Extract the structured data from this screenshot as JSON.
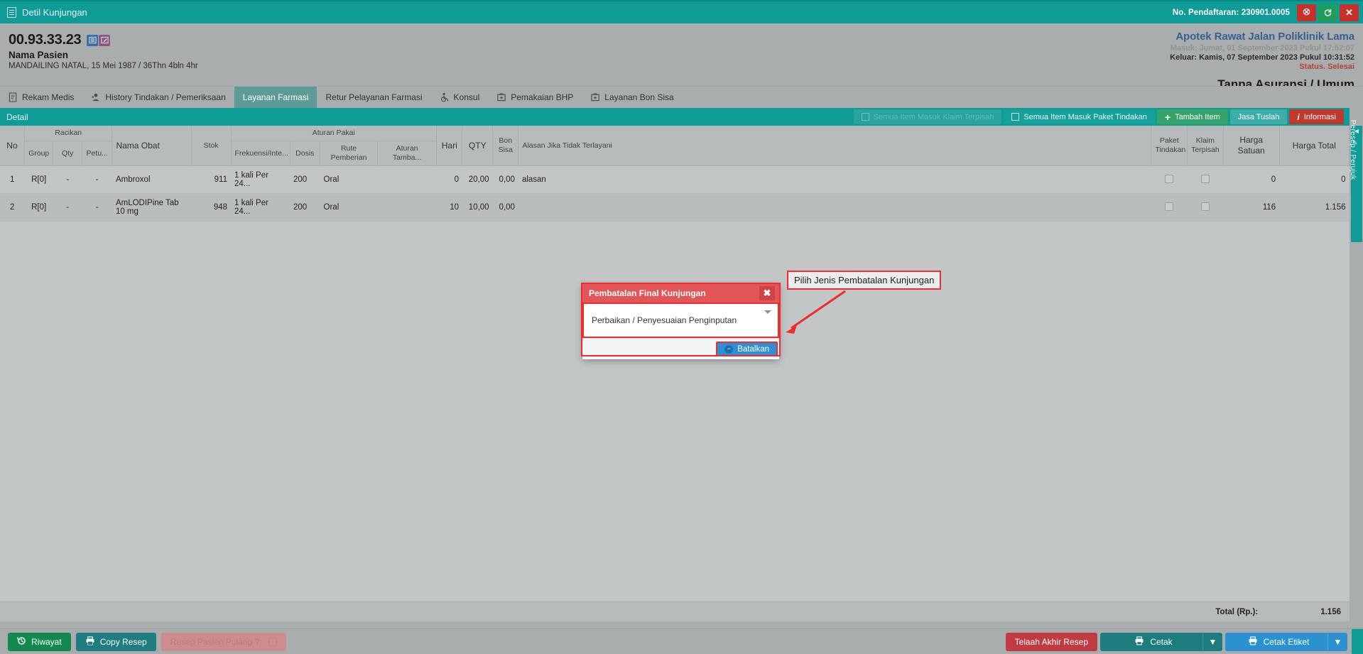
{
  "titlebar": {
    "title": "Detil Kunjungan",
    "doc_icon": "document-icon",
    "registration_label": "No. Pendaftaran: 230901.0005",
    "btn_unlink": "unlink-icon",
    "btn_refresh": "refresh-icon",
    "btn_close": "close-icon"
  },
  "patient": {
    "mrn": "00.93.33.23",
    "icon_list": "list-icon",
    "icon_edit": "edit-icon",
    "name": "Nama Pasien",
    "info": "MANDAILING NATAL, 15 Mei 1987 / 36Thn 4bln 4hr"
  },
  "visit": {
    "clinic": "Apotek Rawat Jalan Poliklinik Lama",
    "masuk": "Masuk: Jumat, 01 September 2023 Pukul 17:52:07",
    "keluar": "Keluar: Kamis, 07 September 2023 Pukul 10:31:52",
    "status": "Status. Selesai",
    "insurance": "Tanpa Asuransi / Umum"
  },
  "tabs": [
    {
      "label": "Rekam Medis",
      "icon": "document-icon",
      "active": false
    },
    {
      "label": "History Tindakan / Pemeriksaan",
      "icon": "patient-icon",
      "active": false
    },
    {
      "label": "Layanan Farmasi",
      "icon": "none",
      "active": true
    },
    {
      "label": "Retur Pelayanan Farmasi",
      "icon": "none",
      "active": false
    },
    {
      "label": "Konsul",
      "icon": "wheelchair-icon",
      "active": false
    },
    {
      "label": "Pemakaian BHP",
      "icon": "medkit-icon",
      "active": false
    },
    {
      "label": "Layanan Bon Sisa",
      "icon": "medkit-icon",
      "active": false
    }
  ],
  "detailbar": {
    "label": "Detail",
    "actions": [
      {
        "name": "semua-item-masuk-klaim-terpisah",
        "label": "Semua Item Masuk Klaim Terpisah",
        "style": "ghost",
        "checkbox": true
      },
      {
        "name": "semua-item-masuk-paket-tindakan",
        "label": "Semua Item Masuk Paket Tindakan",
        "style": "chk",
        "checkbox": true
      },
      {
        "name": "tambah-item",
        "label": "Tambah Item",
        "style": "green",
        "icon": "plus-icon"
      },
      {
        "name": "jasa-tuslah",
        "label": "Jasa Tuslah",
        "style": "teal"
      },
      {
        "name": "informasi",
        "label": "Informasi",
        "style": "red",
        "icon": "info-icon"
      }
    ]
  },
  "table": {
    "header_groups": {
      "racikan": "Racikan",
      "aturan_pakai": "Aturan Pakai"
    },
    "columns": {
      "no": "No",
      "group": "Group",
      "qty_racikan": "Qty",
      "petu": "Petu...",
      "nama_obat": "Nama Obat",
      "stok": "Stok",
      "frekuensi": "Frekuensi/Inte...",
      "dosis": "Dosis",
      "rute": "Rute Pemberian",
      "aturan_tambahan": "Aturan Tamba...",
      "hari": "Hari",
      "qty": "QTY",
      "bon_sisa": "Bon Sisa",
      "alasan": "Alasan Jika Tidak Terlayani",
      "paket_tindakan": "Paket Tindakan",
      "klaim_terpisah": "Klaim Terpisah",
      "harga_satuan": "Harga Satuan",
      "harga_total": "Harga Total"
    },
    "rows": [
      {
        "no": "1",
        "group": "R[0]",
        "qty_racikan": "-",
        "petu": "-",
        "nama_obat": "Ambroxol",
        "stok": "911",
        "frekuensi": "1 kali Per 24...",
        "dosis": "200",
        "rute": "Oral",
        "aturan_tambahan": "",
        "hari": "0",
        "qty": "20,00",
        "bon_sisa": "0,00",
        "alasan": "alasan",
        "harga_satuan": "0",
        "harga_total": "0"
      },
      {
        "no": "2",
        "group": "R[0]",
        "qty_racikan": "-",
        "petu": "-",
        "nama_obat": "AmLODIPine Tab 10 mg",
        "stok": "948",
        "frekuensi": "1 kali Per 24...",
        "dosis": "200",
        "rute": "Oral",
        "aturan_tambahan": "",
        "hari": "10",
        "qty": "10,00",
        "bon_sisa": "0,00",
        "alasan": "",
        "harga_satuan": "116",
        "harga_total": "1.156"
      }
    ]
  },
  "total": {
    "label": "Total (Rp.):",
    "value": "1.156"
  },
  "rightbar": {
    "toggle_icon": "collapse-left-icon",
    "tab_icon": "prescription-icon",
    "tab_label": "Peresep / Perujuk"
  },
  "footer": {
    "riwayat": "Riwayat",
    "riwayat_icon": "history-icon",
    "copy_resep": "Copy Resep",
    "copy_resep_icon": "print-icon",
    "resep_pasien_pulang": "Resep Pasien Pulang ?",
    "telaah_akhir_resep": "Telaah Akhir Resep",
    "cetak": "Cetak",
    "cetak_icon": "print-icon",
    "cetak_etiket": "Cetak Etiket",
    "cetak_etiket_icon": "print-icon",
    "caret": "▼"
  },
  "modal": {
    "title": "Pembatalan Final Kunjungan",
    "close": "✖",
    "select_value": "Perbaikan / Penyesuaian Penginputan",
    "button_label": "Batalkan",
    "button_icon": "minus-circle-icon"
  },
  "annotation": {
    "text": "Pilih Jenis Pembatalan Kunjungan",
    "color": "#f22b2b"
  },
  "colors": {
    "teal": "#0f9b96",
    "bg": "#a9adad",
    "accent_red": "#f22b2b",
    "blue": "#2e8fd4",
    "clinic_blue": "#3a5f8f",
    "status_red": "#b5413b"
  }
}
